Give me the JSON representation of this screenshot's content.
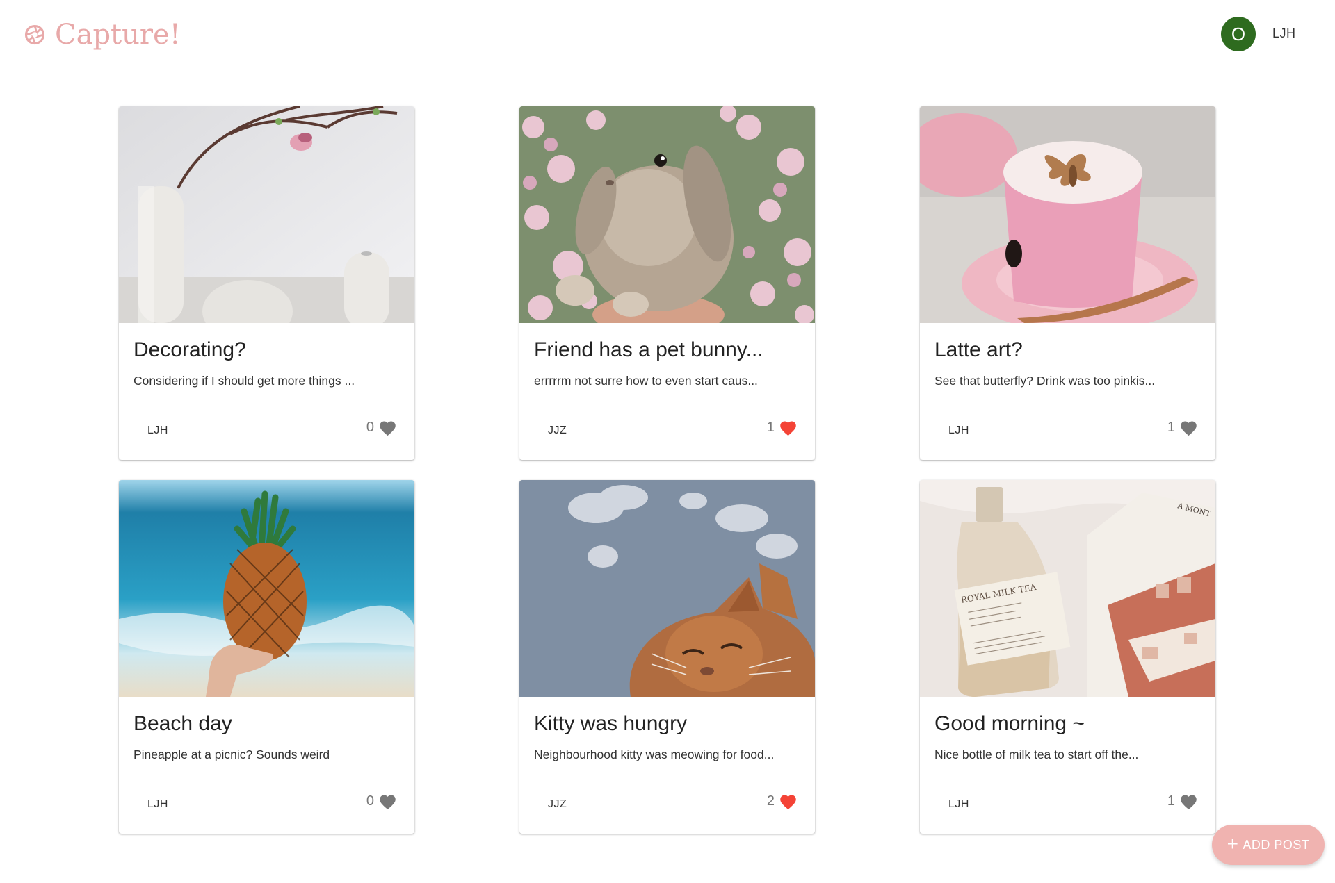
{
  "header": {
    "app_name": "Capture!",
    "logo_icon": "aperture-icon",
    "avatar_initial": "O",
    "user_name": "LJH"
  },
  "posts": [
    {
      "title": "Decorating?",
      "description": "Considering if I should get more things ...",
      "author": "LJH",
      "likes": "0",
      "liked": false,
      "image": "white vases with magnolia branch"
    },
    {
      "title": "Friend has a pet bunny...",
      "description": "errrrrm not surre how to even start caus...",
      "author": "JJZ",
      "likes": "1",
      "liked": true,
      "image": "grey rabbit among pink blossoms"
    },
    {
      "title": "Latte art?",
      "description": "See that butterfly? Drink was too pinkis...",
      "author": "LJH",
      "likes": "1",
      "liked": false,
      "image": "pink latte with butterfly art"
    },
    {
      "title": "Beach day",
      "description": "Pineapple at a picnic? Sounds weird",
      "author": "LJH",
      "likes": "0",
      "liked": false,
      "image": "pineapple held at the beach"
    },
    {
      "title": "Kitty was hungry",
      "description": "Neighbourhood kitty was meowing for food...",
      "author": "JJZ",
      "likes": "2",
      "liked": true,
      "image": "orange cat under the sky"
    },
    {
      "title": "Good morning ~",
      "description": "Nice bottle of milk tea to start off the...",
      "author": "LJH",
      "likes": "1",
      "liked": false,
      "image": "bottle of milk tea with a magazine"
    }
  ],
  "bottle_label": "ROYAL MILK TEA",
  "magazine_label": "A MONT",
  "add_post": {
    "label": "ADD POST",
    "icon": "plus-icon"
  },
  "colors": {
    "brand": "#e8a9a9",
    "avatar_bg": "#2e6b1f",
    "liked": "#f44336",
    "unliked": "#777777",
    "fab_bg": "#f0b3b0"
  }
}
